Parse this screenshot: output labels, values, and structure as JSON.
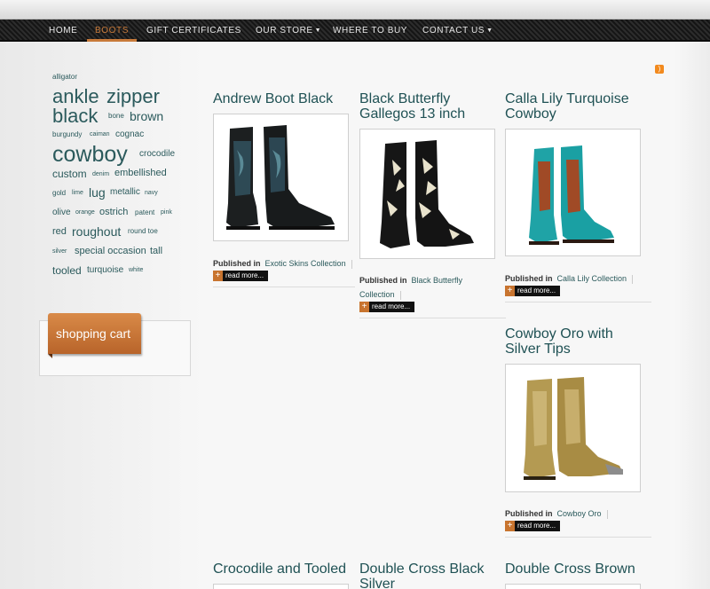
{
  "nav": {
    "items": [
      {
        "label": "HOME"
      },
      {
        "label": "BOOTS"
      },
      {
        "label": "GIFT CERTIFICATES"
      },
      {
        "label": "OUR STORE"
      },
      {
        "label": "WHERE TO BUY"
      },
      {
        "label": "CONTACT US"
      }
    ],
    "active_color": "#c87a3a"
  },
  "tag_cloud": {
    "tags": [
      "alligator",
      "ankle",
      "zipper",
      "black",
      "bone",
      "brown",
      "burgundy",
      "caiman",
      "cognac",
      "cowboy",
      "crocodile",
      "custom",
      "denim",
      "embellished",
      "gold",
      "lime",
      "lug",
      "metallic",
      "navy",
      "olive",
      "orange",
      "ostrich",
      "patent",
      "pink",
      "red",
      "roughout",
      "round toe",
      "silver",
      "special occasion",
      "tall",
      "tooled",
      "turquoise",
      "white"
    ],
    "color": "#2b5a5c"
  },
  "cart": {
    "title": "shopping cart",
    "accent": "#c8742f"
  },
  "posts": {
    "published_label": "Published in",
    "read_more": "read more...",
    "items": [
      {
        "title": "Andrew Boot Black",
        "collection": "Exotic Skins Collection"
      },
      {
        "title": "Black Butterfly Gallegos 13 inch",
        "collection": "Black Butterfly Collection"
      },
      {
        "title": "Calla Lily Turquoise Cowboy",
        "collection": "Calla Lily Collection"
      },
      {
        "title": "Cowboy Oro with Silver Tips",
        "collection": "Cowboy Oro"
      },
      {
        "title": "Crocodile and Tooled"
      },
      {
        "title": "Double Cross Black Silver"
      },
      {
        "title": "Double Cross Brown"
      }
    ]
  }
}
